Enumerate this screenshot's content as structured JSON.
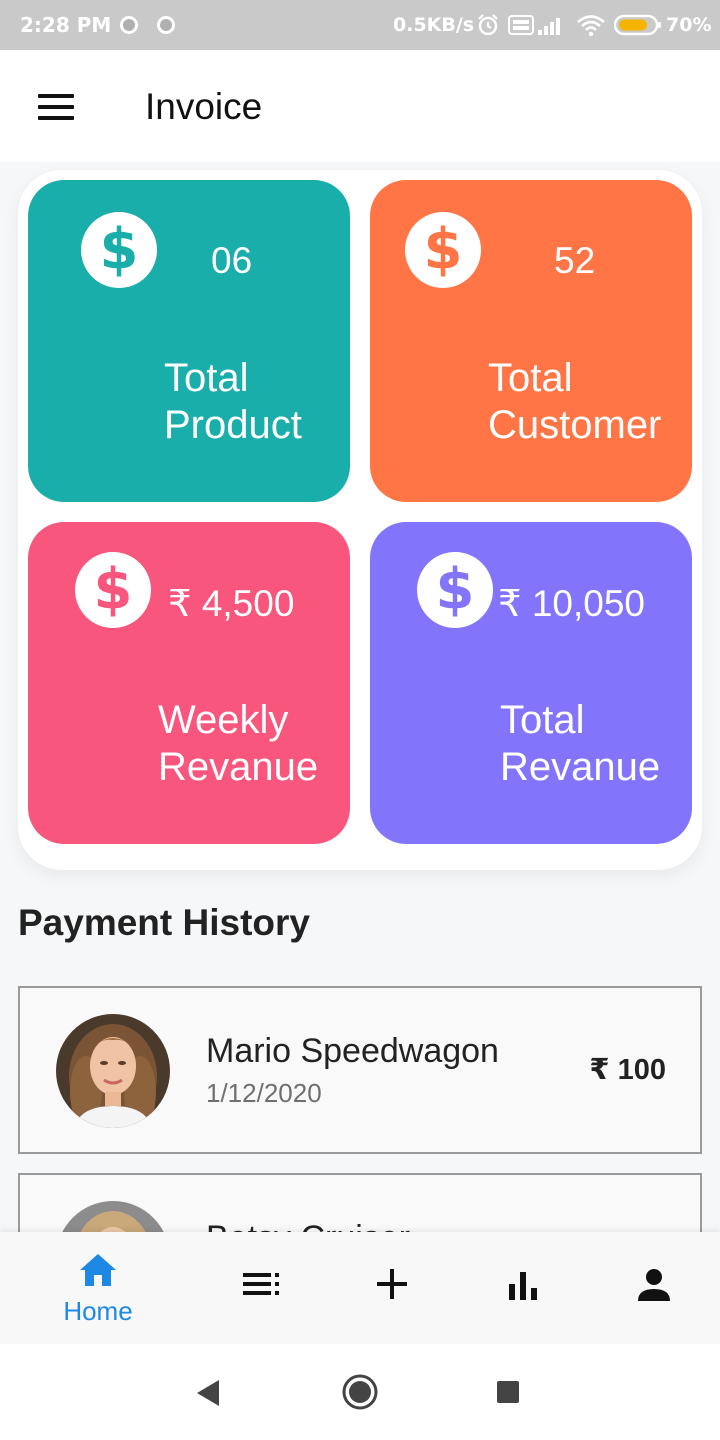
{
  "status_bar": {
    "time": "2:28 PM",
    "net_speed": "0.5KB/s",
    "battery_pct": "70%"
  },
  "appbar": {
    "title": "Invoice"
  },
  "cards": [
    {
      "value": "06",
      "label_line1": "Total",
      "label_line2": "Product",
      "color": "#1aaeab"
    },
    {
      "value": "52",
      "label_line1": "Total",
      "label_line2": "Customer",
      "color": "#ff7545"
    },
    {
      "value": "₹ 4,500",
      "label_line1": "Weekly",
      "label_line2": "Revanue",
      "color": "#f8567c"
    },
    {
      "value": "₹ 10,050",
      "label_line1": "Total",
      "label_line2": "Revanue",
      "color": "#8375fb"
    }
  ],
  "section_title": "Payment History",
  "payments": [
    {
      "name": "Mario Speedwagon",
      "date": "1/12/2020",
      "amount": "₹ 100"
    },
    {
      "name": "Betsy Cruiser"
    }
  ],
  "bottom_nav": {
    "items": [
      {
        "icon": "home-icon",
        "label": "Home",
        "active": true
      },
      {
        "icon": "list-icon"
      },
      {
        "icon": "add-icon"
      },
      {
        "icon": "bar-chart-icon"
      },
      {
        "icon": "person-icon"
      }
    ],
    "active_color": "#1e88e5"
  },
  "icon_color_dollar": "dollar-circle-icon"
}
